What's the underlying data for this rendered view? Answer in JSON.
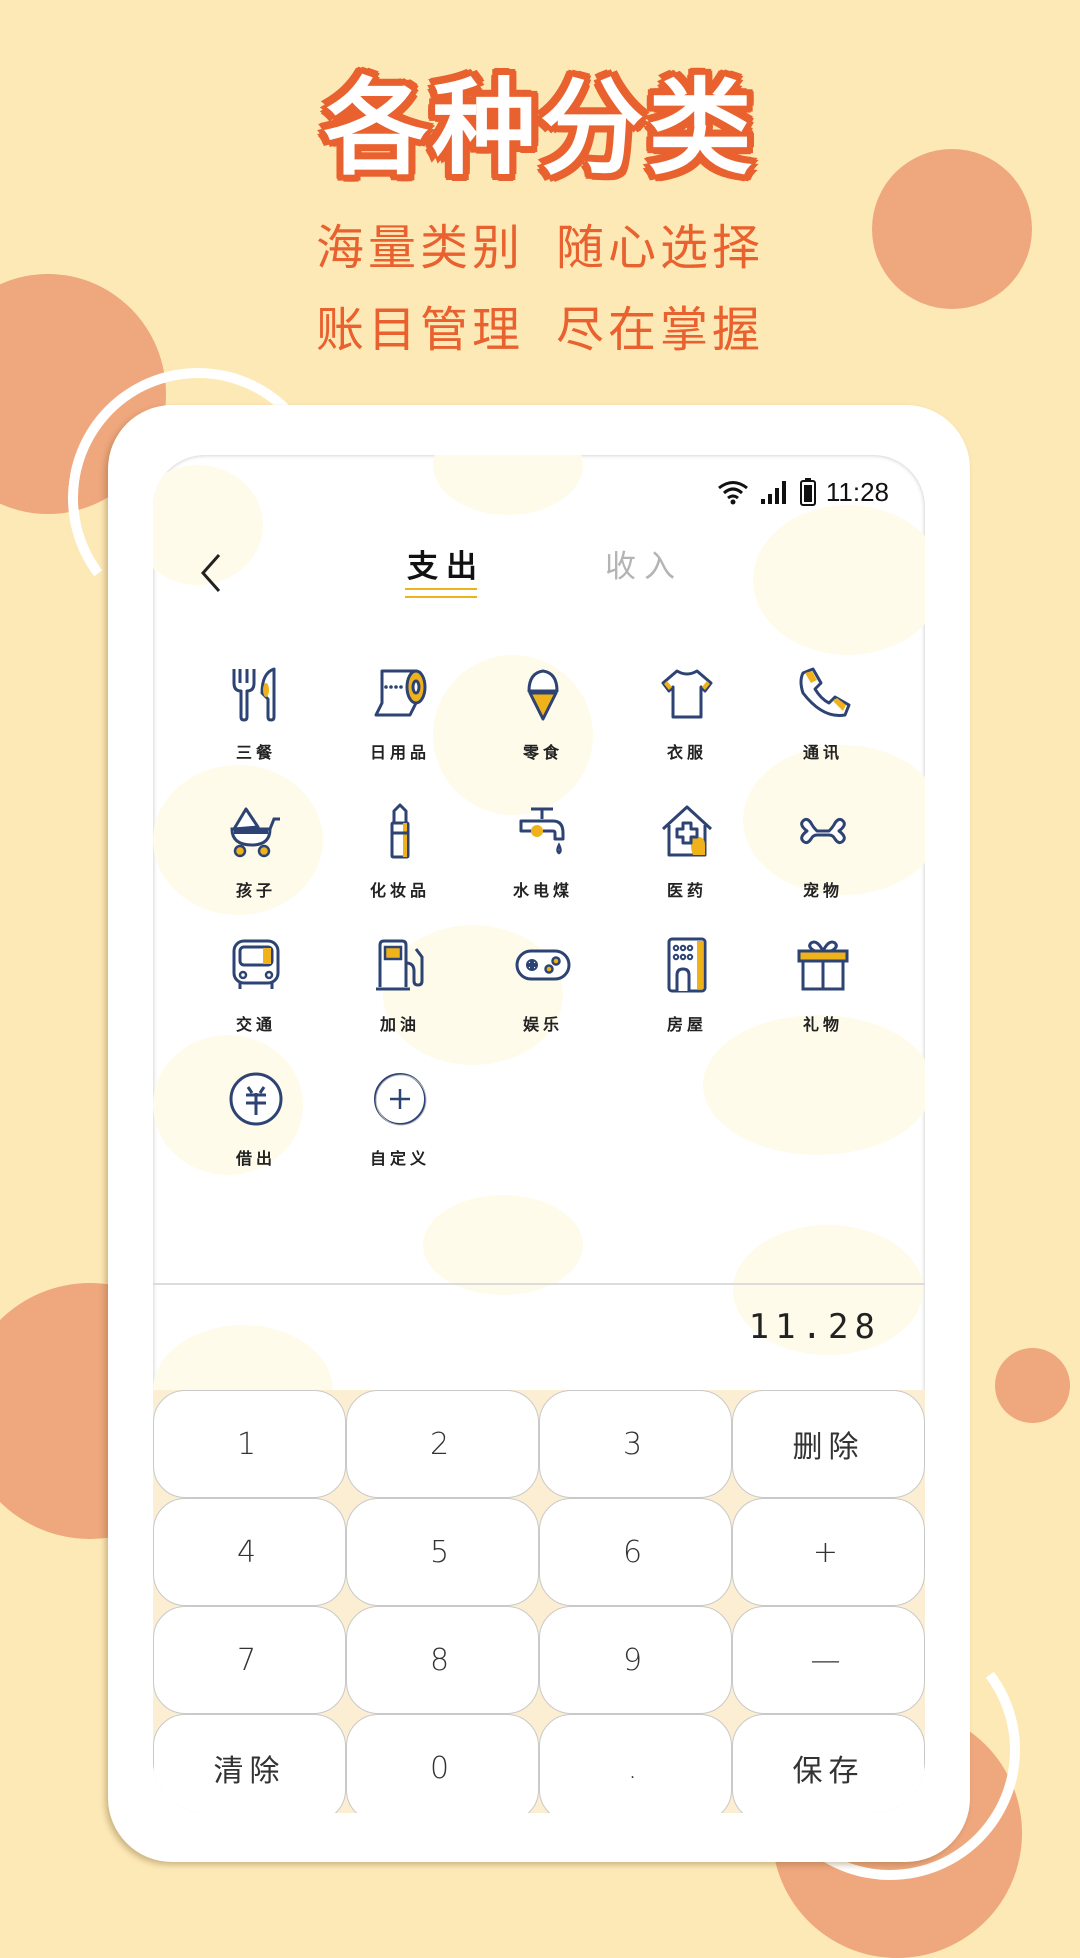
{
  "promo": {
    "headline": "各种分类",
    "subline1_a": "海量类别",
    "subline1_b": "随心选择",
    "subline2_a": "账目管理",
    "subline2_b": "尽在掌握"
  },
  "status_bar": {
    "wifi_icon": "wifi-icon",
    "signal_icon": "signal-icon",
    "battery_icon": "battery-icon",
    "time": "11:28"
  },
  "header": {
    "back_icon": "chevron-left-icon",
    "tabs": [
      {
        "label": "支出",
        "active": true
      },
      {
        "label": "收入",
        "active": false
      }
    ]
  },
  "categories": [
    {
      "label": "三餐",
      "icon": "fork-knife-icon"
    },
    {
      "label": "日用品",
      "icon": "toilet-paper-icon"
    },
    {
      "label": "零食",
      "icon": "ice-cream-icon"
    },
    {
      "label": "衣服",
      "icon": "tshirt-icon"
    },
    {
      "label": "通讯",
      "icon": "phone-icon"
    },
    {
      "label": "孩子",
      "icon": "stroller-icon"
    },
    {
      "label": "化妆品",
      "icon": "lipstick-icon"
    },
    {
      "label": "水电煤",
      "icon": "faucet-icon"
    },
    {
      "label": "医药",
      "icon": "medical-house-icon"
    },
    {
      "label": "宠物",
      "icon": "bone-icon"
    },
    {
      "label": "交通",
      "icon": "bus-icon"
    },
    {
      "label": "加油",
      "icon": "fuel-pump-icon"
    },
    {
      "label": "娱乐",
      "icon": "gamepad-icon"
    },
    {
      "label": "房屋",
      "icon": "building-icon"
    },
    {
      "label": "礼物",
      "icon": "gift-icon"
    },
    {
      "label": "借出",
      "icon": "yuan-coin-icon"
    },
    {
      "label": "自定义",
      "icon": "plus-circle-icon"
    }
  ],
  "amount": "11.28",
  "keypad": [
    "1",
    "2",
    "3",
    "删除",
    "4",
    "5",
    "6",
    "+",
    "7",
    "8",
    "9",
    "—",
    "清除",
    "0",
    ".",
    "保存"
  ],
  "colors": {
    "background": "#fde9b6",
    "accent_orange": "#e8612e",
    "deco_circle": "#efa77d",
    "icon_navy": "#2d4373",
    "icon_yellow": "#f0b21a"
  }
}
